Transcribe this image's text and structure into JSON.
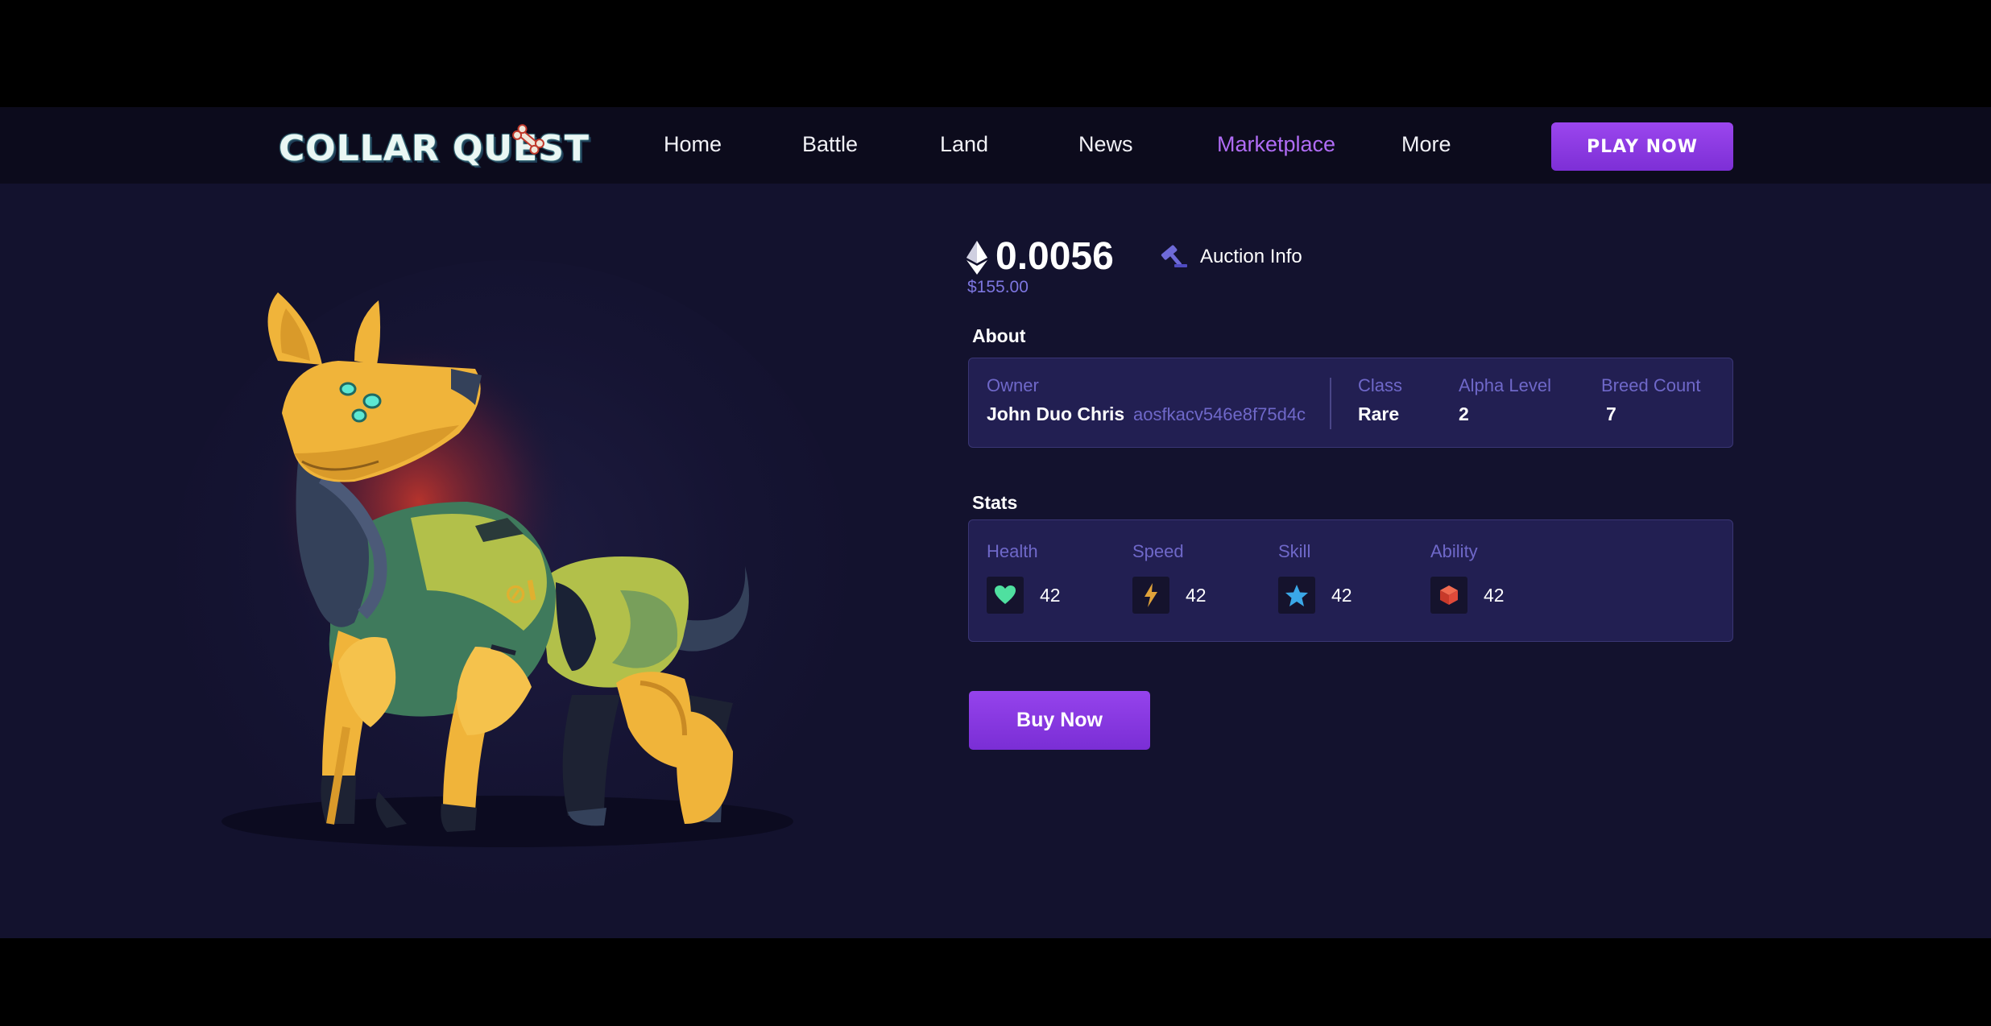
{
  "nav": {
    "logo_text": "COLLAR QUEST",
    "links": [
      {
        "label": "Home",
        "active": false
      },
      {
        "label": "Battle",
        "active": false
      },
      {
        "label": "Land",
        "active": false
      },
      {
        "label": "News",
        "active": false
      },
      {
        "label": "Marketplace",
        "active": true
      },
      {
        "label": "More",
        "active": false
      }
    ],
    "play_label": "PLAY NOW"
  },
  "listing": {
    "price": "0.0056",
    "price_usd": "$155.00",
    "auction_label": "Auction Info"
  },
  "about": {
    "title": "About",
    "owner_label": "Owner",
    "owner_name": "John Duo Chris",
    "owner_address": "aosfkacv546e8f75d4c",
    "class_label": "Class",
    "class_value": "Rare",
    "alpha_label": "Alpha Level",
    "alpha_value": "2",
    "breed_label": "Breed Count",
    "breed_value": "7"
  },
  "stats": {
    "title": "Stats",
    "items": [
      {
        "label": "Health",
        "value": "42",
        "icon": "heart-icon",
        "color": "#4fe0a0"
      },
      {
        "label": "Speed",
        "value": "42",
        "icon": "lightning-icon",
        "color": "#e0a33a"
      },
      {
        "label": "Skill",
        "value": "42",
        "icon": "star-icon",
        "color": "#3aa8e8"
      },
      {
        "label": "Ability",
        "value": "42",
        "icon": "cube-icon",
        "color": "#e04a3a"
      }
    ]
  },
  "buy_label": "Buy Now",
  "colors": {
    "accent": "#9b46ee",
    "background": "#13122e",
    "nav_bg": "#0c0b1c",
    "card_bg": "#221f52",
    "label": "#6f68c9"
  }
}
